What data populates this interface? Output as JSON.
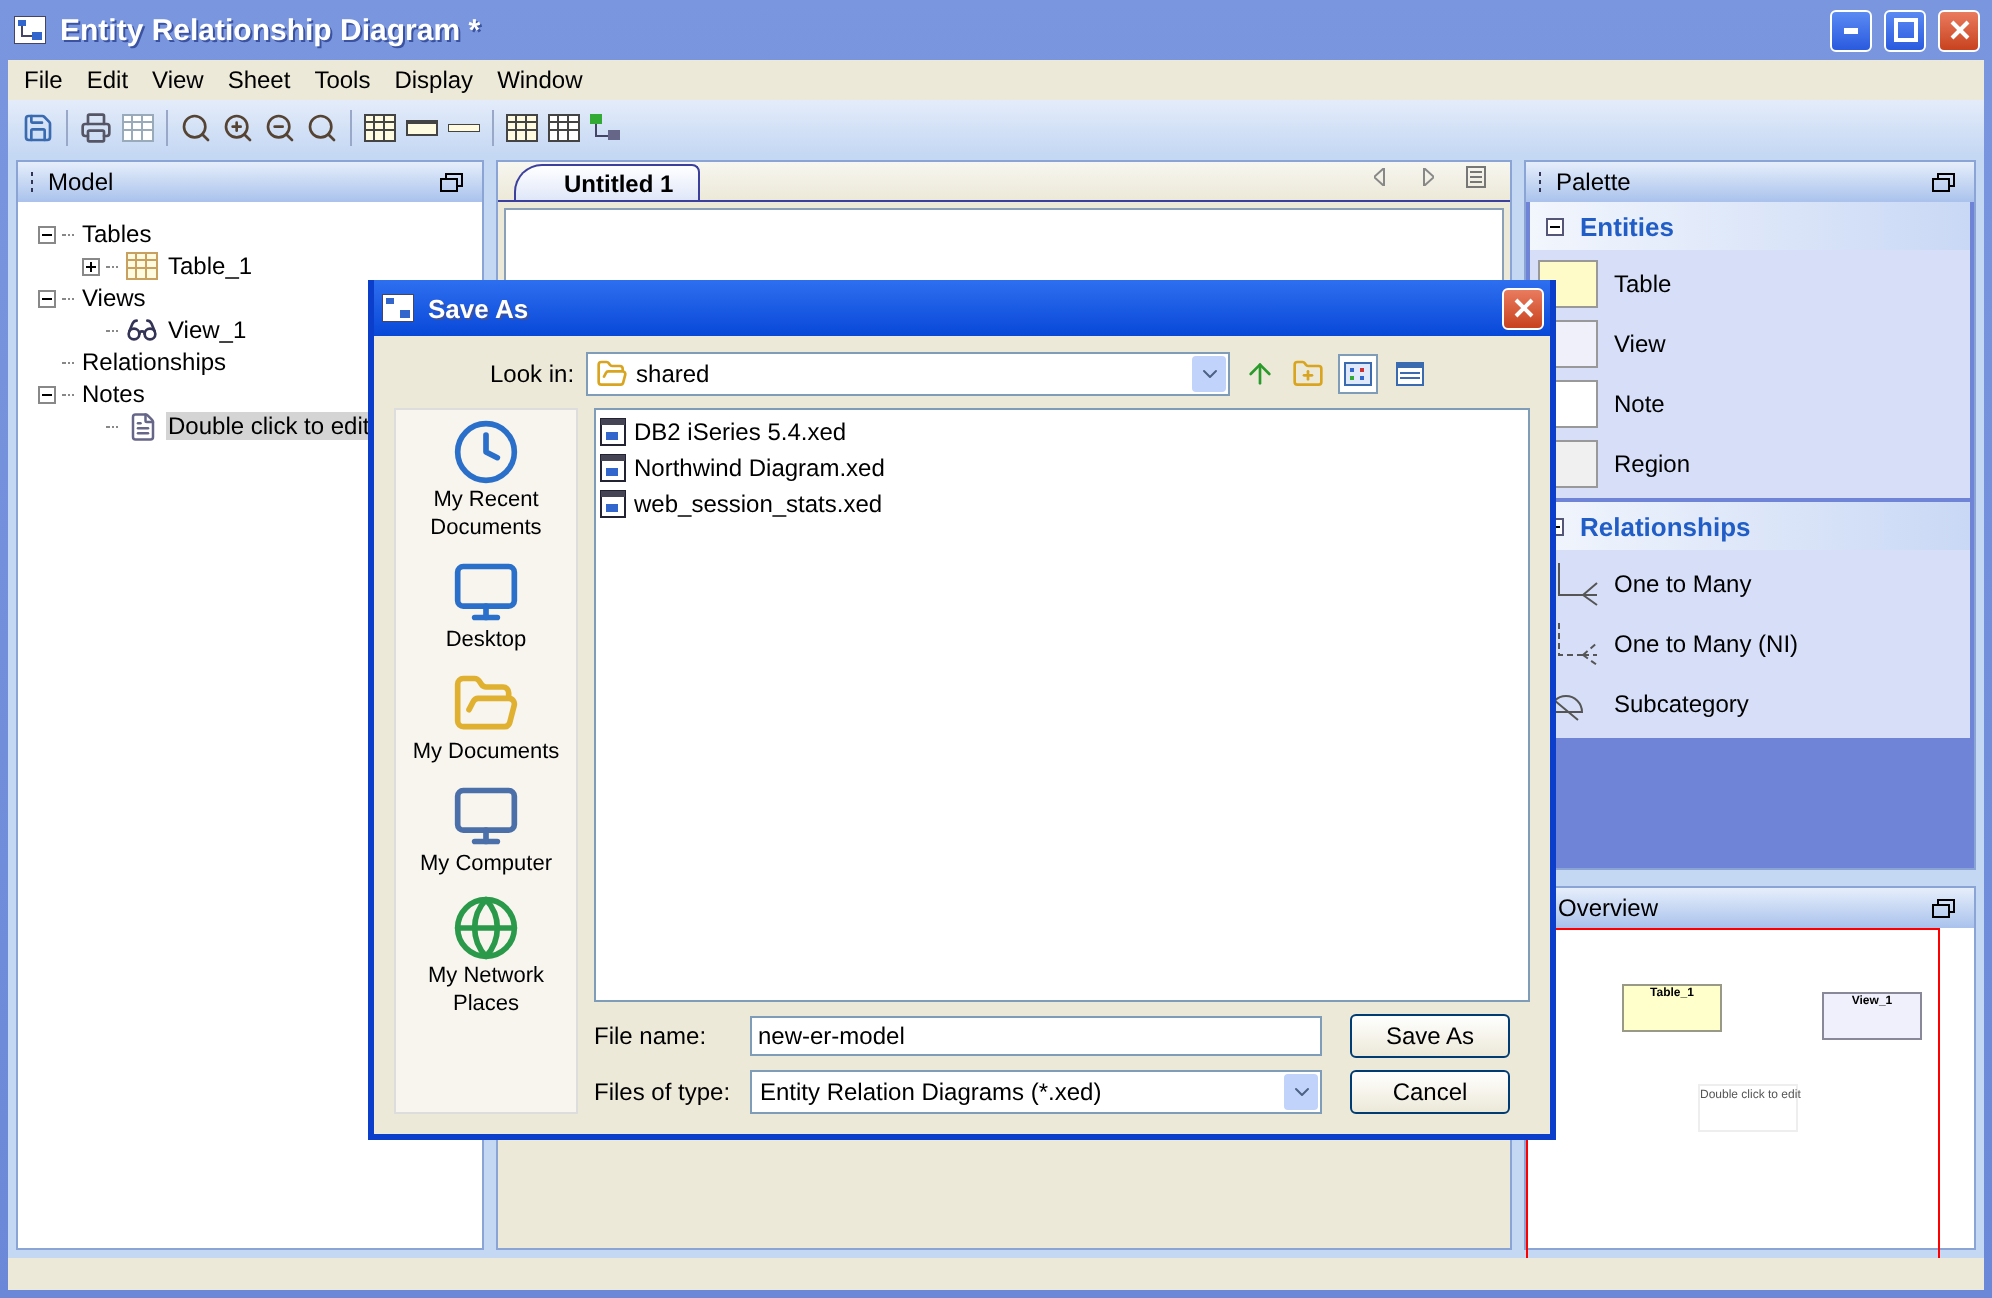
{
  "window": {
    "title": "Entity Relationship Diagram *"
  },
  "menu": [
    "File",
    "Edit",
    "View",
    "Sheet",
    "Tools",
    "Display",
    "Window"
  ],
  "model_panel": {
    "title": "Model",
    "tree": [
      {
        "label": "Tables",
        "expanded": true,
        "selected": false,
        "children": [
          {
            "label": "Table_1",
            "kind": "table",
            "expanded": false,
            "selected": false
          }
        ]
      },
      {
        "label": "Views",
        "expanded": true,
        "selected": false,
        "children": [
          {
            "label": "View_1",
            "kind": "view",
            "selected": false
          }
        ]
      },
      {
        "label": "Relationships",
        "selected": false
      },
      {
        "label": "Notes",
        "expanded": true,
        "selected": false,
        "children": [
          {
            "label": "Double click to edit",
            "kind": "note",
            "selected": true
          }
        ]
      }
    ]
  },
  "editor": {
    "tabs": [
      {
        "label": "Untitled 1",
        "selected": true
      }
    ]
  },
  "palette": {
    "title": "Palette",
    "sections": [
      {
        "title": "Entities",
        "expanded": true,
        "items": [
          {
            "label": "Table",
            "kind": "table"
          },
          {
            "label": "View",
            "kind": "view"
          },
          {
            "label": "Note",
            "kind": "note"
          },
          {
            "label": "Region",
            "kind": "region"
          }
        ]
      },
      {
        "title": "Relationships",
        "expanded": true,
        "items": [
          {
            "label": "One to Many",
            "kind": "one-to-many"
          },
          {
            "label": "One to Many (NI)",
            "kind": "one-to-many-ni"
          },
          {
            "label": "Subcategory",
            "kind": "subcategory"
          }
        ]
      }
    ]
  },
  "overview": {
    "title": "Overview",
    "nodes": [
      {
        "label": "Table_1",
        "kind": "table"
      },
      {
        "label": "View_1",
        "kind": "view"
      },
      {
        "label": "Double click to edit",
        "kind": "note"
      }
    ]
  },
  "dialog": {
    "title": "Save As",
    "look_in": {
      "label": "Look in:",
      "value": "shared"
    },
    "view_buttons": [
      {
        "kind": "list",
        "selected": true
      },
      {
        "kind": "details",
        "selected": false
      }
    ],
    "places": [
      {
        "label": "My Recent Documents",
        "kind": "recent"
      },
      {
        "label": "Desktop",
        "kind": "desktop"
      },
      {
        "label": "My Documents",
        "kind": "documents"
      },
      {
        "label": "My Computer",
        "kind": "computer"
      },
      {
        "label": "My Network Places",
        "kind": "network"
      }
    ],
    "files": [
      "DB2 iSeries 5.4.xed",
      "Northwind Diagram.xed",
      "web_session_stats.xed"
    ],
    "file_name": {
      "label": "File name:",
      "value": "new-er-model"
    },
    "file_type": {
      "label": "Files of type:",
      "value": "Entity Relation Diagrams (*.xed)"
    },
    "buttons": [
      "Save As",
      "Cancel"
    ]
  }
}
